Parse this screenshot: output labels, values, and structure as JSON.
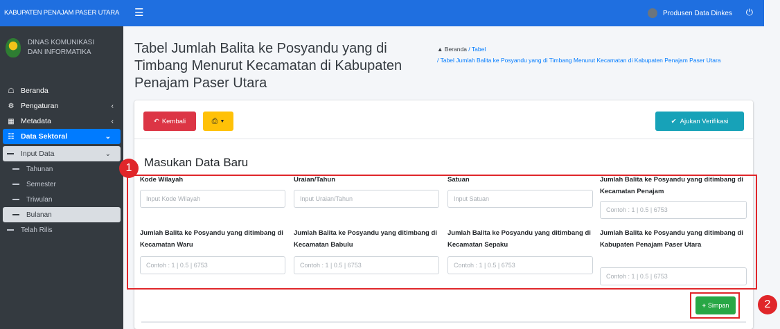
{
  "brand": "KABUPATEN PENAJAM PASER UTARA",
  "org": {
    "line1": "DINAS KOMUNIKASI",
    "line2": "DAN INFORMATIKA"
  },
  "sidebar": {
    "items": [
      {
        "label": "Beranda",
        "icon": "home-icon"
      },
      {
        "label": "Pengaturan",
        "icon": "cogs-icon"
      },
      {
        "label": "Metadata",
        "icon": "table-icon"
      },
      {
        "label": "Data Sektoral",
        "icon": "database-icon"
      },
      {
        "label": "Input Data"
      },
      {
        "label": "Tahunan"
      },
      {
        "label": "Semester"
      },
      {
        "label": "Triwulan"
      },
      {
        "label": "Bulanan"
      },
      {
        "label": "Telah Rilis"
      }
    ]
  },
  "topbar": {
    "user": "Produsen Data Dinkes"
  },
  "page": {
    "title": "Tabel Jumlah Balita ke Posyandu yang di Timbang Menurut Kecamatan di Kabupaten Penajam Paser Utara",
    "breadcrumb": {
      "home": "Beranda",
      "level1": "Tabel",
      "current": "Tabel Jumlah Balita ke Posyandu yang di Timbang Menurut Kecamatan di Kabupaten Penajam Paser Utara"
    }
  },
  "buttons": {
    "back": "Kembali",
    "verify": "Ajukan Verifikasi",
    "save": "Simpan"
  },
  "form": {
    "section_title": "Masukan Data Baru",
    "fields": [
      {
        "label": "Kode Wilayah",
        "placeholder": "Input Kode Wilayah"
      },
      {
        "label": "Uraian/Tahun",
        "placeholder": "Input Uraian/Tahun"
      },
      {
        "label": "Satuan",
        "placeholder": "Input Satuan"
      },
      {
        "label": "Jumlah Balita ke Posyandu yang ditimbang di Kecamatan Penajam",
        "placeholder": "Contoh : 1 | 0.5 | 6753"
      },
      {
        "label": "Jumlah Balita ke Posyandu yang ditimbang di Kecamatan Waru",
        "placeholder": "Contoh : 1 | 0.5 | 6753"
      },
      {
        "label": "Jumlah Balita ke Posyandu yang ditimbang di Kecamatan Babulu",
        "placeholder": "Contoh : 1 | 0.5 | 6753"
      },
      {
        "label": "Jumlah Balita ke Posyandu yang ditimbang di Kecamatan Sepaku",
        "placeholder": "Contoh : 1 | 0.5 | 6753"
      },
      {
        "label": "Jumlah Balita ke Posyandu yang ditimbang di Kabupaten Penajam Paser Utara",
        "placeholder": "Contoh : 1 | 0.5 | 6753"
      }
    ]
  },
  "annotations": {
    "one": "1",
    "two": "2"
  },
  "colors": {
    "primary": "#1f6fe0",
    "sidebar": "#343a40",
    "danger": "#dc3545",
    "warning": "#ffc107",
    "info": "#17a2b8",
    "success": "#28a745",
    "highlight": "#e0262a"
  }
}
